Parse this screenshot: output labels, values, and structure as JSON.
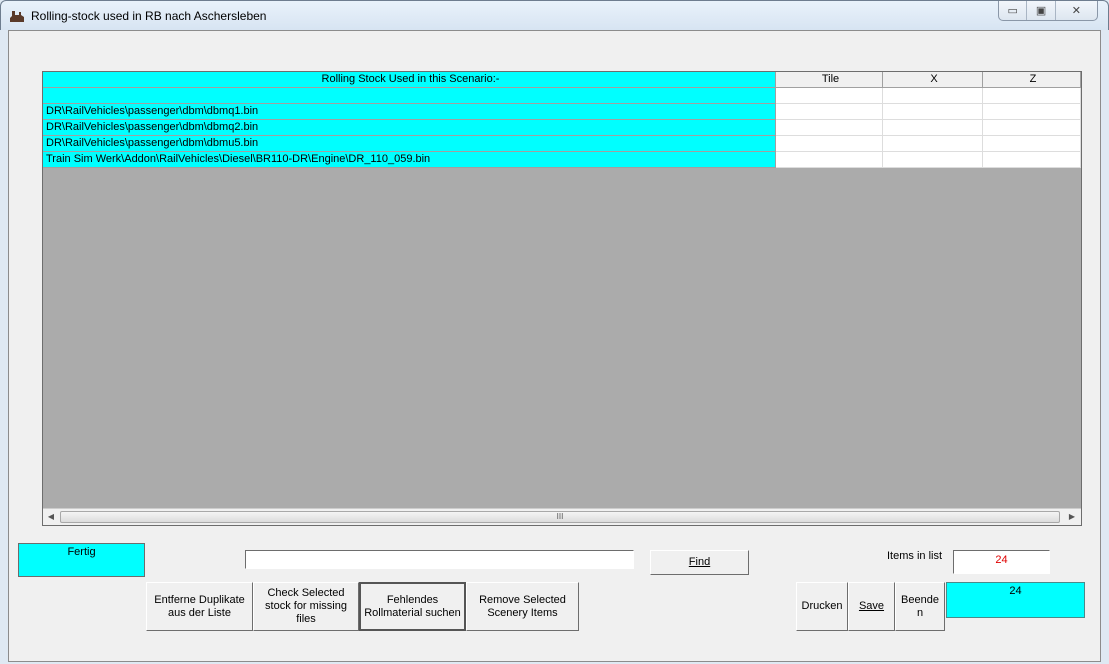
{
  "window": {
    "title": "Rolling-stock used in RB nach Aschersleben",
    "minimize": "▭",
    "maximize": "▣",
    "close": "✕"
  },
  "grid": {
    "headers": [
      "Rolling Stock Used in this Scenario:-",
      "Tile",
      "X",
      "Z"
    ],
    "rows": [
      [
        "",
        "",
        "",
        ""
      ],
      [
        "DR\\RailVehicles\\passenger\\dbm\\dbmq1.bin",
        "",
        "",
        ""
      ],
      [
        "DR\\RailVehicles\\passenger\\dbm\\dbmq2.bin",
        "",
        "",
        ""
      ],
      [
        "DR\\RailVehicles\\passenger\\dbm\\dbmu5.bin",
        "",
        "",
        ""
      ],
      [
        "Train Sim Werk\\Addon\\RailVehicles\\Diesel\\BR110-DR\\Engine\\DR_110_059.bin",
        "",
        "",
        ""
      ]
    ],
    "scroll_thumb": "III"
  },
  "status": "Fertig",
  "search": {
    "value": "",
    "find_label": "Find"
  },
  "buttons": {
    "remove_duplicates": [
      "Entferne Duplikate",
      "aus der Liste"
    ],
    "check_selected": [
      "Check Selected",
      "stock for missing files"
    ],
    "find_missing": [
      "Fehlendes",
      "Rollmaterial suchen"
    ],
    "remove_scenery": [
      "Remove Selected",
      "Scenery Items"
    ],
    "print": "Drucken",
    "save": "Save",
    "exit": [
      "Beende",
      "n"
    ]
  },
  "items": {
    "label": "Items in list",
    "count": "24",
    "count_color": "#e00000",
    "secondary": "24"
  },
  "colors": {
    "accent": "#00ffff"
  }
}
